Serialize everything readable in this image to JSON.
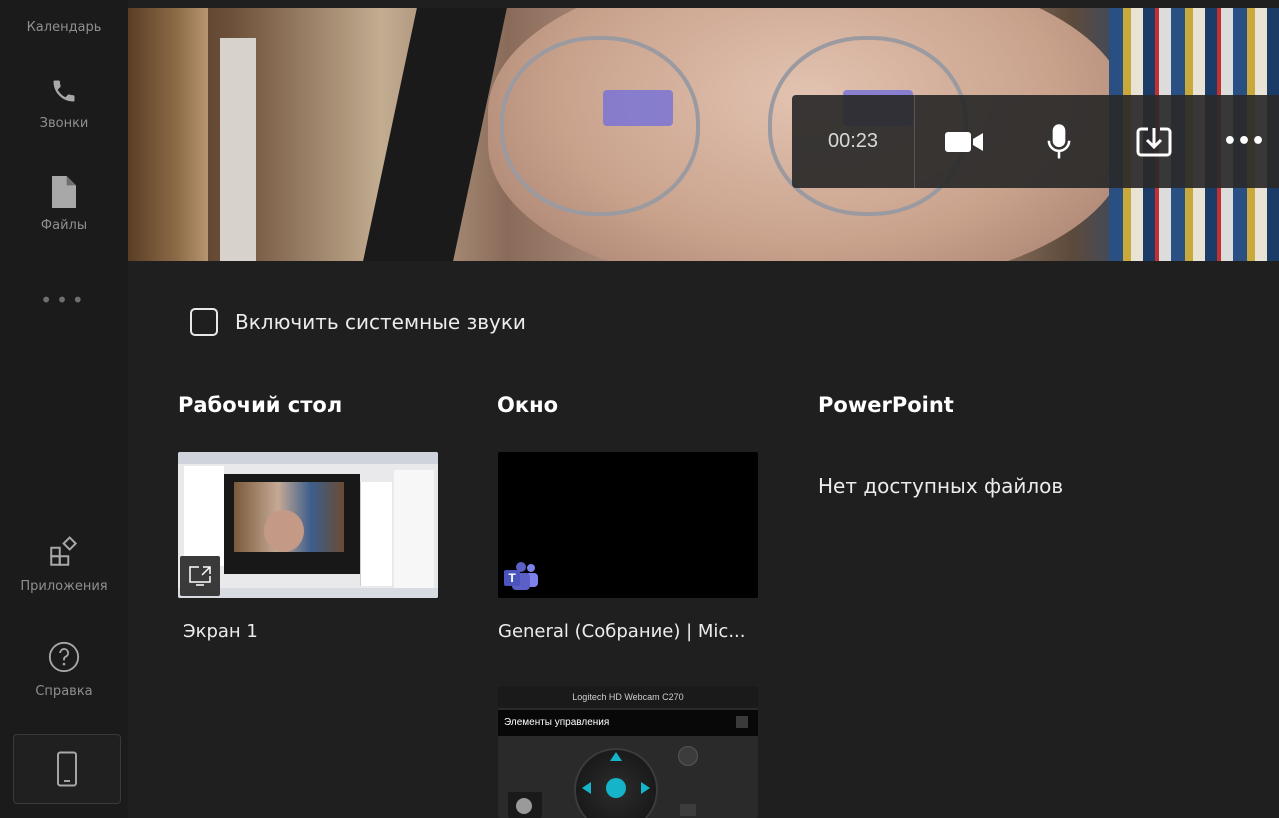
{
  "rail": {
    "calendar_label": "Календарь",
    "calls_label": "Звонки",
    "files_label": "Файлы",
    "more_label": "•••",
    "apps_label": "Приложения",
    "help_label": "Справка"
  },
  "call": {
    "timer": "00:23",
    "camera_icon": "camera-icon",
    "mic_icon": "microphone-icon",
    "share_icon": "share-tray-icon",
    "more_icon": "more-options-icon",
    "more_glyph": "•••"
  },
  "share": {
    "system_sounds_label": "Включить системные звуки",
    "system_sounds_checked": false,
    "desktop_title": "Рабочий стол",
    "window_title": "Окно",
    "powerpoint_title": "PowerPoint",
    "desktop_items": [
      {
        "label": "Экран 1"
      }
    ],
    "window_items": [
      {
        "label": "General (Собрание) | Mic..."
      },
      {
        "label": ""
      }
    ],
    "webcam_window_title": "Logitech HD Webcam C270",
    "webcam_window_subtitle": "Элементы управления",
    "powerpoint_empty": "Нет доступных файлов"
  },
  "colors": {
    "background": "#1f1f1f",
    "rail": "#1b1b1b",
    "text": "#ffffff",
    "teams_purple": "#5b5fc7"
  }
}
